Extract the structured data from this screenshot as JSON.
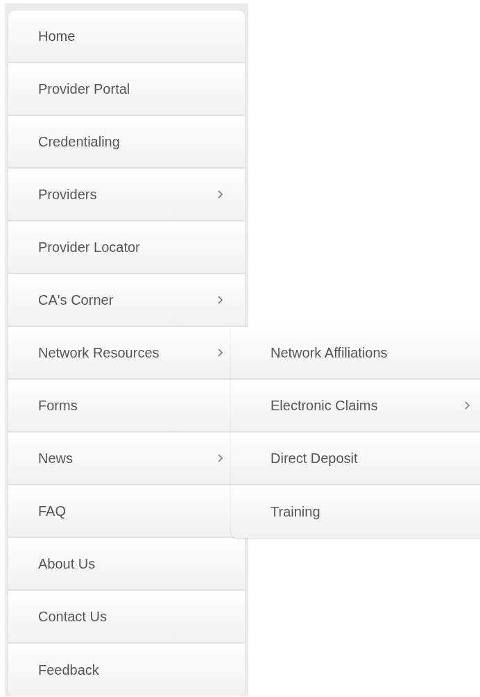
{
  "menu": {
    "items": [
      {
        "label": "Home",
        "has_submenu": false
      },
      {
        "label": "Provider Portal",
        "has_submenu": false
      },
      {
        "label": "Credentialing",
        "has_submenu": false
      },
      {
        "label": "Providers",
        "has_submenu": true
      },
      {
        "label": "Provider Locator",
        "has_submenu": false
      },
      {
        "label": "CA's Corner",
        "has_submenu": true
      },
      {
        "label": "Network Resources",
        "has_submenu": true,
        "expanded": true,
        "children": [
          {
            "label": "Network Affiliations",
            "has_submenu": false
          },
          {
            "label": "Electronic Claims",
            "has_submenu": true
          },
          {
            "label": "Direct Deposit",
            "has_submenu": false
          },
          {
            "label": "Training",
            "has_submenu": false
          }
        ]
      },
      {
        "label": "Forms",
        "has_submenu": false
      },
      {
        "label": "News",
        "has_submenu": true
      },
      {
        "label": "FAQ",
        "has_submenu": false
      },
      {
        "label": "About Us",
        "has_submenu": false
      },
      {
        "label": "Contact Us",
        "has_submenu": false
      },
      {
        "label": "Feedback",
        "has_submenu": false
      }
    ]
  }
}
